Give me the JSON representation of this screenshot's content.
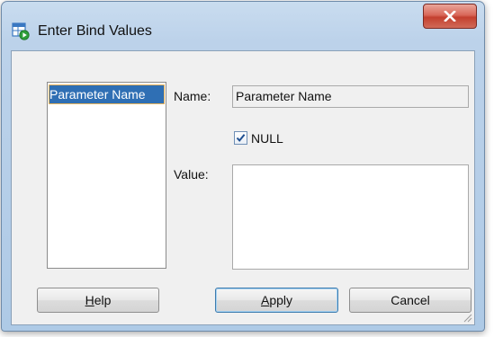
{
  "window": {
    "title": "Enter Bind Values",
    "close_label": "X"
  },
  "parameters": {
    "items": [
      "Parameter Name"
    ],
    "selected_index": 0
  },
  "form": {
    "name_label": "Name:",
    "name_value": "Parameter Name",
    "null_label": "NULL",
    "null_checked": true,
    "value_label": "Value:",
    "value_text": ""
  },
  "buttons": {
    "help": {
      "mnemonic": "H",
      "rest": "elp"
    },
    "apply": {
      "mnemonic": "A",
      "rest": "pply"
    },
    "cancel": "Cancel"
  },
  "colors": {
    "selection": "#2f6fb4",
    "close_button": "#c4402f",
    "window_frame": "#aecae6"
  }
}
